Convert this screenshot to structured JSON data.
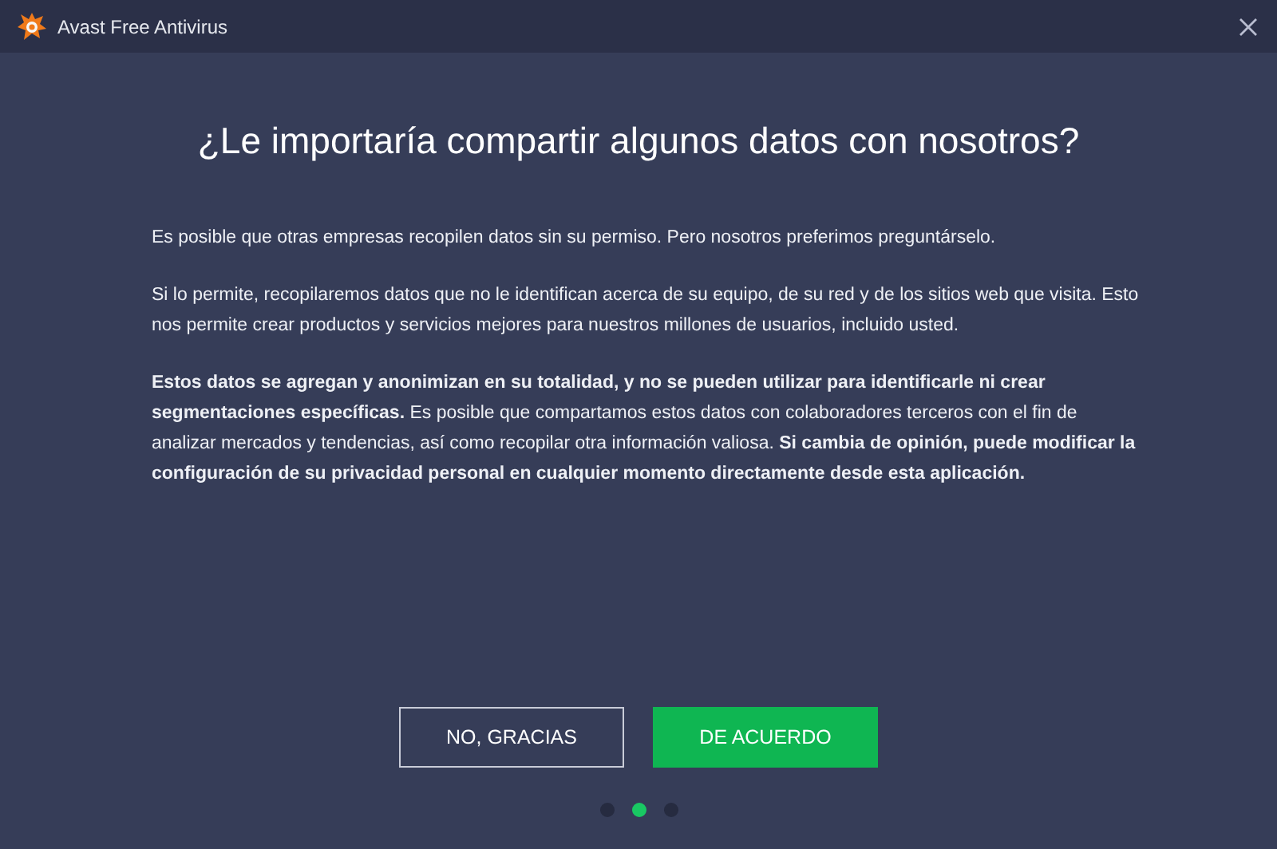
{
  "window": {
    "title": "Avast Free Antivirus"
  },
  "heading": "¿Le importaría compartir algunos datos con nosotros?",
  "paragraphs": [
    "Es posible que otras empresas recopilen datos sin su permiso. Pero nosotros preferimos preguntárselo.",
    "Si lo permite, recopilaremos datos que no le identifican acerca de su equipo, de su red y de los sitios web que visita. Esto nos permite crear productos y servicios mejores para nuestros millones de usuarios, incluido usted.",
    "**Estos datos se agregan y anonimizan en su totalidad, y no se pueden utilizar para identificarle ni crear segmentaciones específicas.** Es posible que compartamos estos datos con colaboradores terceros con el fin de analizar mercados y tendencias, así como recopilar otra información valiosa. **Si cambia de opinión, puede modificar la configuración de su privacidad personal en cualquier momento directamente desde esta aplicación.**"
  ],
  "buttons": [
    {
      "label": "NO, GRACIAS",
      "kind": "outline"
    },
    {
      "label": "DE ACUERDO",
      "kind": "primary"
    }
  ],
  "pager": [
    {
      "selected": false
    },
    {
      "selected": true
    },
    {
      "selected": false
    }
  ]
}
